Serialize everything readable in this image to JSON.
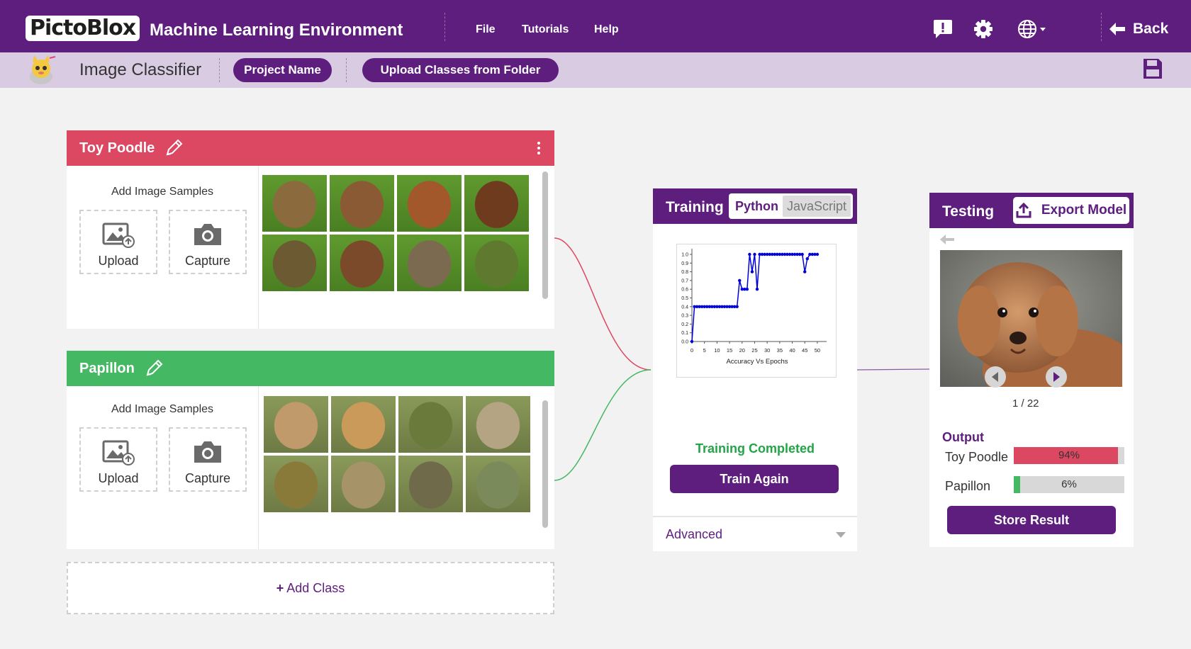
{
  "app": {
    "logo_text": "PictoBlox",
    "title": "Machine Learning Environment",
    "menu": [
      "File",
      "Tutorials",
      "Help"
    ],
    "back_label": "Back",
    "icons": [
      "feedback-icon",
      "settings-gear-icon",
      "language-globe-icon",
      "back-arrow-icon",
      "save-icon"
    ]
  },
  "subbar": {
    "title": "Image Classifier",
    "project_button": "Project Name",
    "upload_button": "Upload Classes from Folder"
  },
  "classes": [
    {
      "name": "Toy Poodle",
      "color": "#dc4861",
      "add_samples_label": "Add Image Samples",
      "upload_label": "Upload",
      "capture_label": "Capture",
      "thumb_colors": [
        "#8b6a3d",
        "#8a5a34",
        "#a2582a",
        "#6f3b1f",
        "#6c5a32",
        "#7a4a2a",
        "#7b6a50",
        "#5f7a2f"
      ]
    },
    {
      "name": "Papillon",
      "color": "#45b864",
      "add_samples_label": "Add Image Samples",
      "upload_label": "Upload",
      "capture_label": "Capture",
      "thumb_colors": [
        "#c09a6a",
        "#c99a5a",
        "#6a7a3a",
        "#b5a483",
        "#8a7a3a",
        "#a69468",
        "#6e6a4a",
        "#7a8a5a"
      ]
    }
  ],
  "add_class_label": "Add Class",
  "training": {
    "title": "Training",
    "tabs": [
      "Python",
      "JavaScript"
    ],
    "active_tab": "Python",
    "status": "Training Completed",
    "train_again_label": "Train Again",
    "advanced_label": "Advanced",
    "status_color": "#22a447"
  },
  "testing": {
    "title": "Testing",
    "export_label": "Export Model",
    "page_indicator": "1 / 22",
    "output_label": "Output",
    "results": [
      {
        "label": "Toy Poodle",
        "percent_text": "94%",
        "fraction": 0.94,
        "color": "#dc4861"
      },
      {
        "label": "Papillon",
        "percent_text": "6%",
        "fraction": 0.06,
        "color": "#45b864"
      }
    ],
    "store_label": "Store Result"
  },
  "chart_data": {
    "type": "line",
    "title": "",
    "xlabel": "Accuracy Vs Epochs",
    "ylabel": "",
    "xlim": [
      0,
      52
    ],
    "ylim": [
      0,
      1.0
    ],
    "xticks": [
      0,
      5,
      10,
      15,
      20,
      25,
      30,
      35,
      40,
      45,
      50
    ],
    "yticks": [
      0.0,
      0.1,
      0.2,
      0.3,
      0.4,
      0.5,
      0.6,
      0.7,
      0.8,
      0.9,
      1.0
    ],
    "grid": false,
    "series": [
      {
        "color": "#0000dd",
        "x": [
          0,
          1,
          2,
          3,
          4,
          5,
          6,
          7,
          8,
          9,
          10,
          11,
          12,
          13,
          14,
          15,
          16,
          17,
          18,
          19,
          20,
          21,
          22,
          23,
          24,
          25,
          26,
          27,
          28,
          29,
          30,
          31,
          32,
          33,
          34,
          35,
          36,
          37,
          38,
          39,
          40,
          41,
          42,
          43,
          44,
          45,
          46,
          47,
          48,
          49,
          50
        ],
        "y": [
          0.0,
          0.4,
          0.4,
          0.4,
          0.4,
          0.4,
          0.4,
          0.4,
          0.4,
          0.4,
          0.4,
          0.4,
          0.4,
          0.4,
          0.4,
          0.4,
          0.4,
          0.4,
          0.4,
          0.7,
          0.6,
          0.6,
          0.6,
          1.0,
          0.8,
          1.0,
          0.6,
          1.0,
          1.0,
          1.0,
          1.0,
          1.0,
          1.0,
          1.0,
          1.0,
          1.0,
          1.0,
          1.0,
          1.0,
          1.0,
          1.0,
          1.0,
          1.0,
          1.0,
          1.0,
          0.8,
          0.95,
          1.0,
          1.0,
          1.0,
          1.0
        ]
      }
    ]
  }
}
